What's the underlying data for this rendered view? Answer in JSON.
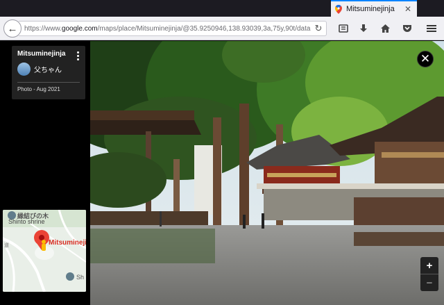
{
  "tab": {
    "title": "Mitsuminejinja",
    "icon": "google-maps-pin-icon"
  },
  "url": {
    "prefix": "https://www.",
    "domain": "google.com",
    "path": "/maps/place/Mitsuminejinja/@35.9250946,138.93039,3a,75y,90t/data="
  },
  "card": {
    "place_name": "Mitsuminejinja",
    "author": "父ちゃん",
    "date": "Photo - Aug 2021"
  },
  "minimap": {
    "label_top": "縁結びの木",
    "label_shrine": "Shinto shrine",
    "label_place": "Mitsuminejinja",
    "label_edge": "Sh",
    "label_road": "道"
  },
  "zoom": {
    "in": "+",
    "out": "−"
  },
  "colors": {
    "accent": "#0a84ff",
    "pin": "#ea4335",
    "place_label": "#d93025"
  }
}
